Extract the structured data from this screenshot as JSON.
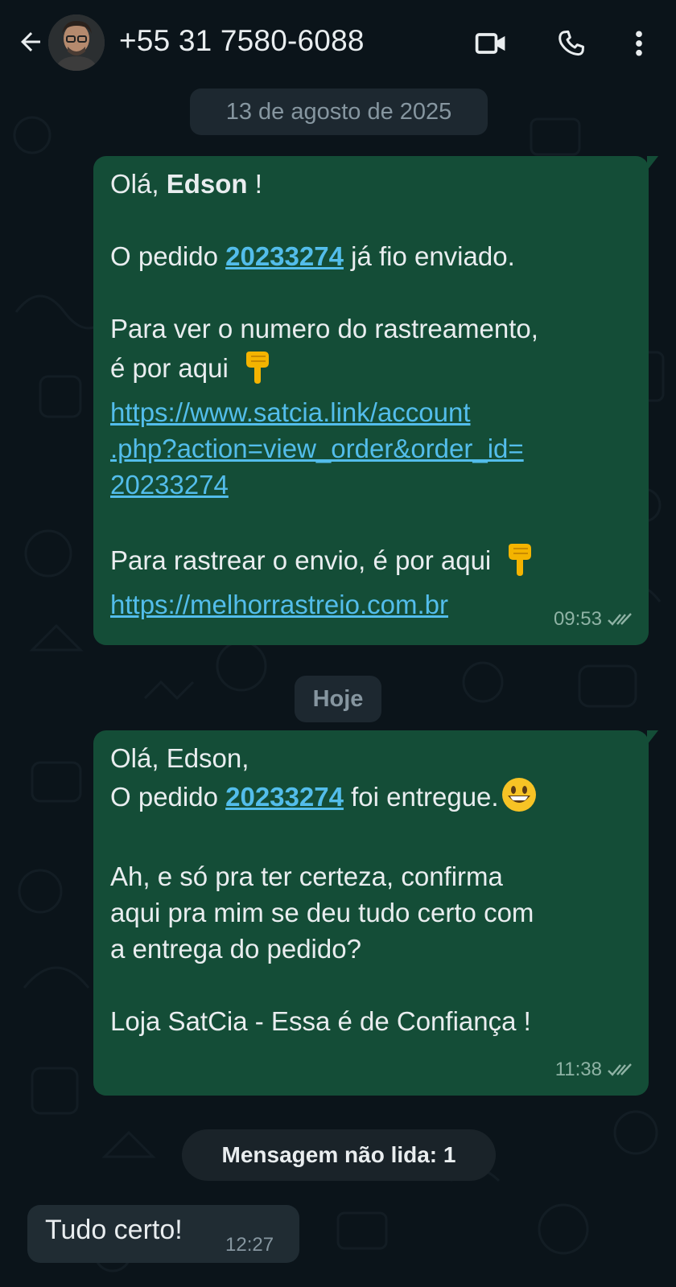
{
  "header": {
    "contact_name": "+55 31 7580-6088",
    "back_icon": "arrow-left-icon",
    "video_icon": "video-camera-icon",
    "call_icon": "phone-icon",
    "menu_icon": "vertical-dots-icon"
  },
  "colors": {
    "background": "#0b141a",
    "outgoing_bubble": "#144d37",
    "incoming_bubble": "#202c33",
    "link": "#53bdeb",
    "date_pill": "#1d2830"
  },
  "chat": {
    "date_1": "13 de agosto de 2025",
    "date_2": "Hoje",
    "unread_banner": "Mensagem não lida: 1",
    "message_1": {
      "greeting_prefix": "Olá, ",
      "greeting_name": "Edson",
      "greeting_suffix": " !",
      "order_prefix": "O pedido ",
      "order_number": "20233274",
      "order_suffix": " já fio enviado.",
      "tracking_line_1": "Para ver o numero do rastreamento,",
      "tracking_line_2": "é por aqui",
      "link_1_line_1": "https://www.satcia.link/account",
      "link_1_line_2": ".php?action=view_order&order_id=",
      "link_1_line_3": "20233274",
      "shipping_text": "Para rastrear o envio, é por aqui",
      "link_2": "https://melhorrastreio.com.br",
      "time": "09:53",
      "status_icon": "double-check-icon"
    },
    "message_2": {
      "line_1": "Olá, Edson,",
      "order_prefix": "O pedido ",
      "order_number": "20233274",
      "order_suffix": " foi entregue.",
      "confirm_line_1": "Ah, e só pra ter certeza, confirma",
      "confirm_line_2": "aqui pra mim se deu tudo certo com",
      "confirm_line_3": "a entrega do pedido?",
      "signature": "Loja SatCia - Essa é de Confiança !",
      "time": "11:38",
      "status_icon": "double-check-icon"
    },
    "message_3": {
      "text": "Tudo certo!",
      "time": "12:27"
    }
  }
}
